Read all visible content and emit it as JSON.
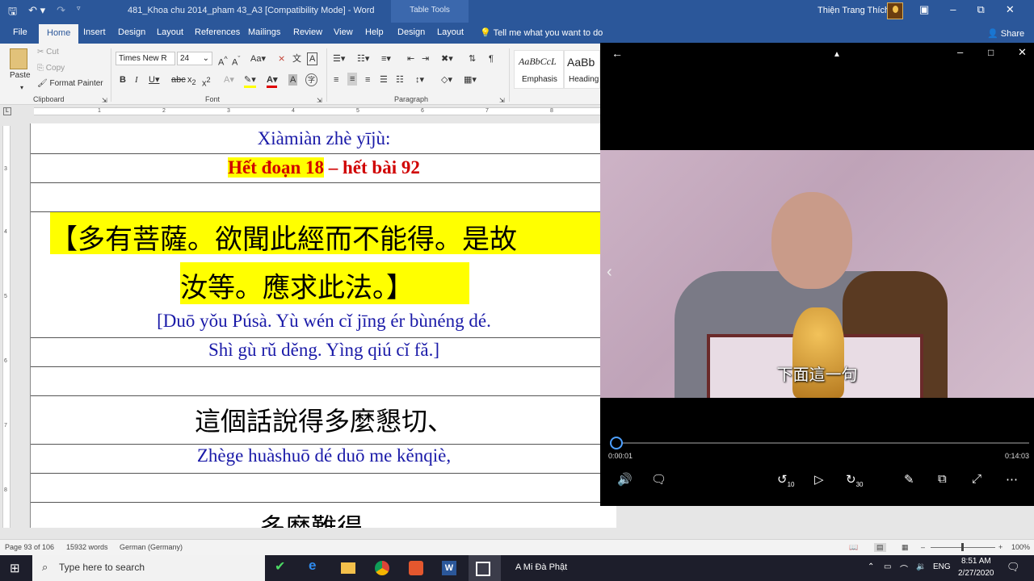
{
  "titlebar": {
    "document_title": "481_Khoa chu 2014_pham 43_A3 [Compatibility Mode]  -  Word",
    "table_tools": "Table Tools",
    "user": "Thiện Trang Thích",
    "save_icon": "save-icon",
    "undo_icon": "undo-icon",
    "redo_icon": "redo-icon"
  },
  "ribbon_tabs": [
    "File",
    "Home",
    "Insert",
    "Design",
    "Layout",
    "References",
    "Mailings",
    "Review",
    "View",
    "Help",
    "Design",
    "Layout"
  ],
  "tell_me": "Tell me what you want to do",
  "share": "Share",
  "clipboard": {
    "paste": "Paste",
    "cut": "Cut",
    "copy": "Copy",
    "format_painter": "Format Painter",
    "label": "Clipboard"
  },
  "font": {
    "name": "Times New R",
    "size": "24",
    "label": "Font"
  },
  "paragraph": {
    "label": "Paragraph"
  },
  "styles": [
    {
      "preview": "AaBbCcL",
      "name": "Emphasis"
    },
    {
      "preview": "AaBb",
      "name": "Heading"
    }
  ],
  "document": {
    "line1_pinyin": "Xiàmiàn zhè yījù:",
    "line2_highlight": "Hết đoạn 18",
    "line2_rest": " – hết bài 92",
    "sutra_line1": "【多有菩薩。欲聞此經而不能得。是故",
    "sutra_line2": "汝等。應求此法。】",
    "pinyin_line1": "[Duō yǒu Púsà. Yù wén cǐ jīng ér bùnéng dé.",
    "pinyin_line2": "Shì gù rǔ děng. Yìng qiú cǐ fǎ.]",
    "chinese_line3": "這個話說得多麼懇切、",
    "pinyin_line3": "Zhège huàshuō dé duō me kěnqiè,",
    "chinese_line4": "多麼難得。"
  },
  "statusbar": {
    "page": "Page 93 of 106",
    "words": "15932 words",
    "language": "German (Germany)",
    "zoom": "100%"
  },
  "player": {
    "subtitle": "下面這一句",
    "current_time": "0:00:01",
    "total_time": "0:14:03",
    "progress": 0.0012,
    "skip_back": "10",
    "skip_forward": "30"
  },
  "taskbar": {
    "search_placeholder": "Type here to search",
    "active_window": "A Mi Đà Phật",
    "lang": "ENG",
    "time": "8:51 AM",
    "date": "2/27/2020"
  }
}
